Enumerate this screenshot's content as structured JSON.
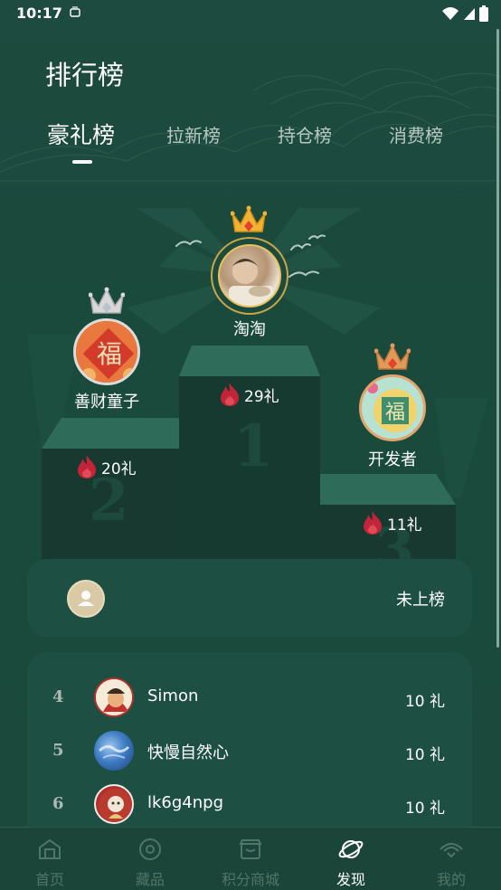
{
  "status_bar": {
    "time": "10:17"
  },
  "header": {
    "title": "排行榜"
  },
  "tabs": [
    {
      "label": "豪礼榜",
      "active": true
    },
    {
      "label": "拉新榜",
      "active": false
    },
    {
      "label": "持仓榜",
      "active": false
    },
    {
      "label": "消费榜",
      "active": false
    }
  ],
  "podium": {
    "first": {
      "rank": "1",
      "name": "淘淘",
      "gifts": "29礼"
    },
    "second": {
      "rank": "2",
      "name": "善财童子",
      "gifts": "20礼"
    },
    "third": {
      "rank": "3",
      "name": "开发者",
      "gifts": "11礼"
    }
  },
  "my_rank": {
    "status": "未上榜"
  },
  "list": [
    {
      "rank": "4",
      "name": "Simon",
      "value": "10 礼"
    },
    {
      "rank": "5",
      "name": "快慢自然心",
      "value": "10 礼"
    },
    {
      "rank": "6",
      "name": "lk6g4npg",
      "value": "10 礼"
    }
  ],
  "bottom_nav": [
    {
      "label": "首页",
      "icon": "home-icon"
    },
    {
      "label": "藏品",
      "icon": "collection-icon"
    },
    {
      "label": "积分商城",
      "icon": "store-icon"
    },
    {
      "label": "发现",
      "icon": "planet-icon",
      "active": true
    },
    {
      "label": "我的",
      "icon": "profile-icon"
    }
  ],
  "colors": {
    "background": "#1a4a3e",
    "card": "#1d4f42",
    "flame": "#c2253a",
    "gold": "#f2b233",
    "silver": "#d8d8d8",
    "bronze": "#e29a5a"
  }
}
